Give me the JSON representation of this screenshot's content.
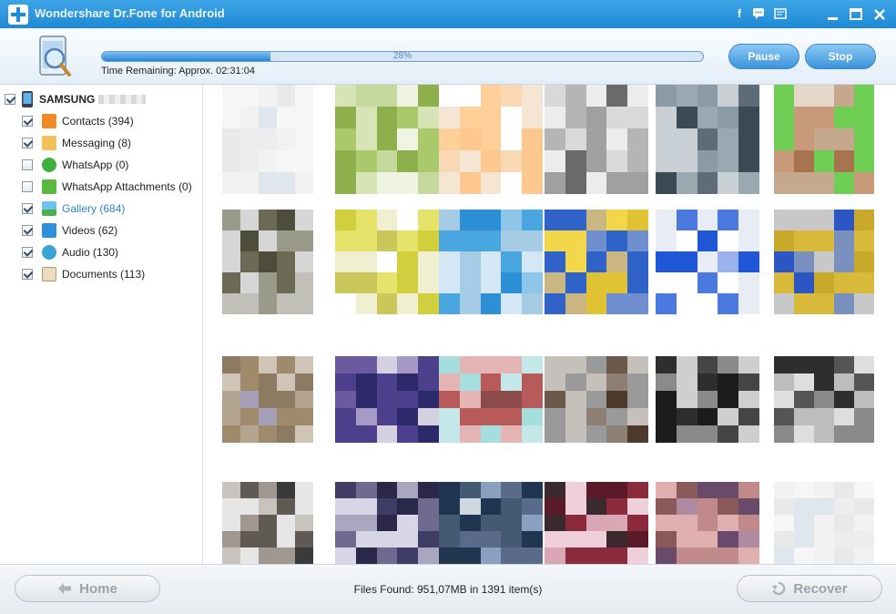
{
  "window": {
    "title": "Wondershare Dr.Fone for Android",
    "icons": [
      "facebook-icon",
      "feedback-icon",
      "menu-icon",
      "minimize-icon",
      "maximize-icon",
      "close-icon"
    ]
  },
  "header": {
    "progress_percent": 28,
    "progress_label": "28%",
    "time_remaining": "Time Remaining: Approx. 02:31:04",
    "pause_label": "Pause",
    "stop_label": "Stop"
  },
  "sidebar": {
    "device_name": "SAMSUNG",
    "items": [
      {
        "label": "Contacts (394)",
        "checked": true,
        "icon": "contacts-icon",
        "active": false
      },
      {
        "label": "Messaging (8)",
        "checked": true,
        "icon": "messaging-icon",
        "active": false
      },
      {
        "label": "WhatsApp (0)",
        "checked": false,
        "icon": "whatsapp-icon",
        "active": false
      },
      {
        "label": "WhatsApp Attachments  (0)",
        "checked": false,
        "icon": "whatsapp-attachments-icon",
        "active": false
      },
      {
        "label": "Gallery (684)",
        "checked": true,
        "icon": "gallery-icon",
        "active": true
      },
      {
        "label": "Videos (62)",
        "checked": true,
        "icon": "videos-icon",
        "active": false
      },
      {
        "label": "Audio (130)",
        "checked": true,
        "icon": "audio-icon",
        "active": false
      },
      {
        "label": "Documents (113)",
        "checked": true,
        "icon": "documents-icon",
        "active": false
      }
    ]
  },
  "footer": {
    "home_label": "Home",
    "recover_label": "Recover",
    "files_found": "Files Found: 951,07MB in 1391 item(s)"
  },
  "colors": {
    "title_bar": "#2a93dc",
    "button_blue": "#3b94dc",
    "active_text": "#2f84c7"
  }
}
